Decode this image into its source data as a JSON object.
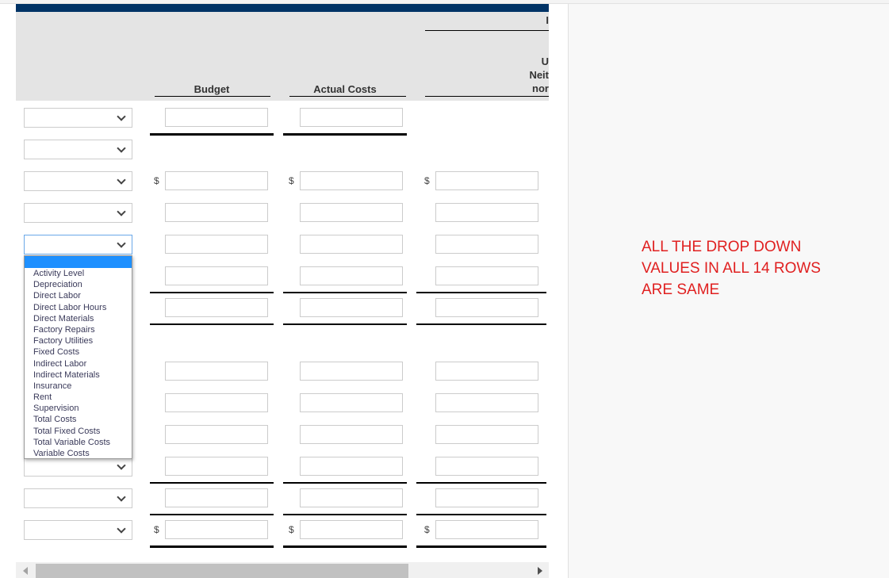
{
  "header": {
    "col_budget": "Budget",
    "col_actual": "Actual Costs",
    "col_third_line1": "U",
    "col_third_line2": "Neit",
    "col_third_line3": "nor",
    "col_group_partial": "I"
  },
  "currency_symbol": "$",
  "dropdown": {
    "open_row": 5,
    "selected": "",
    "options": [
      "Activity Level",
      "Depreciation",
      "Direct Labor",
      "Direct Labor Hours",
      "Direct Materials",
      "Factory Repairs",
      "Factory Utilities",
      "Fixed Costs",
      "Indirect Labor",
      "Indirect Materials",
      "Insurance",
      "Rent",
      "Supervision",
      "Total Costs",
      "Total Fixed Costs",
      "Total Variable Costs",
      "Variable Costs"
    ]
  },
  "note": "ALL THE DROP DOWN VALUES IN ALL 14 ROWS ARE SAME",
  "colors": {
    "header_bar": "#003366",
    "header_bg": "#e4e4e4",
    "highlight": "#1e90ff",
    "note": "#e02020"
  }
}
